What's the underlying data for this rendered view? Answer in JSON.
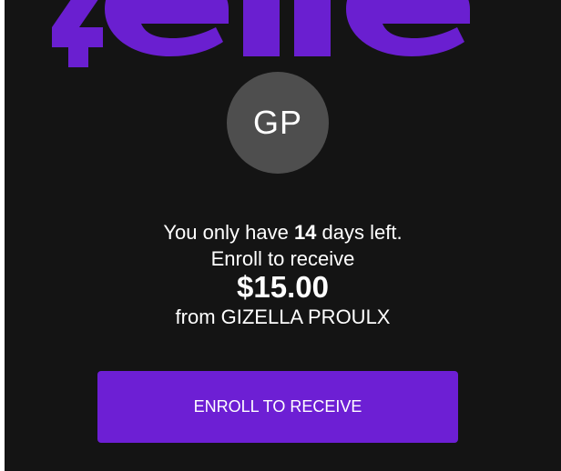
{
  "brand": {
    "logo_icon": "zelle-logo",
    "color": "#6d1fd4"
  },
  "recipient": {
    "initials": "GP"
  },
  "message": {
    "prefix": "You only have ",
    "days": "14",
    "suffix": " days left.",
    "enroll_line": "Enroll to receive",
    "amount": "$15.00",
    "sender_line": "from GIZELLA PROULX"
  },
  "actions": {
    "enroll_label": "ENROLL TO RECEIVE"
  }
}
